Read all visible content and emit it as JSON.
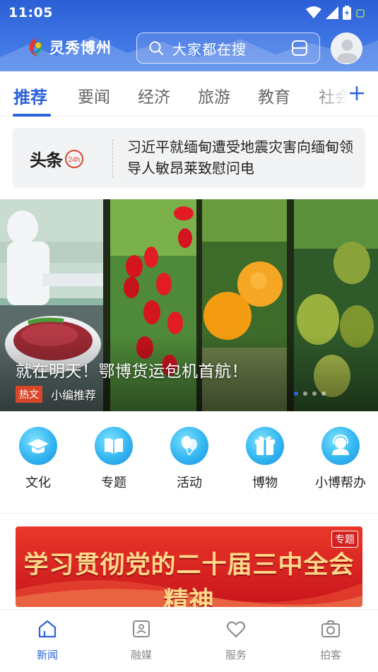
{
  "status_bar": {
    "time": "11:05"
  },
  "header": {
    "app_name": "灵秀博州",
    "search_placeholder": "大家都在搜"
  },
  "tabs": [
    {
      "label": "推荐",
      "active": true
    },
    {
      "label": "要闻",
      "active": false
    },
    {
      "label": "经济",
      "active": false
    },
    {
      "label": "旅游",
      "active": false
    },
    {
      "label": "教育",
      "active": false
    },
    {
      "label": "社会",
      "active": false
    }
  ],
  "headline": {
    "brand": "头条",
    "brand_badge": "24h",
    "text": "习近平就缅甸遭受地震灾害向缅甸领导人敏昂莱致慰问电"
  },
  "banner": {
    "title": "就在明天！鄂博货运包机首航！",
    "tag": "热文",
    "subtitle": "小编推荐",
    "page_count": 4,
    "active_page": 1
  },
  "shortcuts": [
    {
      "label": "文化",
      "icon": "graduation-cap-icon"
    },
    {
      "label": "专题",
      "icon": "book-icon"
    },
    {
      "label": "活动",
      "icon": "balloons-icon"
    },
    {
      "label": "博物",
      "icon": "gift-box-icon"
    },
    {
      "label": "小博帮办",
      "icon": "support-agent-icon"
    }
  ],
  "promo": {
    "text": "学习贯彻党的二十届三中全会精神",
    "tag": "专题"
  },
  "bottom_nav": [
    {
      "label": "新闻",
      "icon": "home-news-icon",
      "active": true
    },
    {
      "label": "融媒",
      "icon": "media-icon",
      "active": false
    },
    {
      "label": "服务",
      "icon": "heart-service-icon",
      "active": false
    },
    {
      "label": "拍客",
      "icon": "camera-icon",
      "active": false
    }
  ],
  "colors": {
    "primary": "#2b63d9",
    "header_bg": "#3d74e3",
    "tag_red": "#d9472b"
  }
}
